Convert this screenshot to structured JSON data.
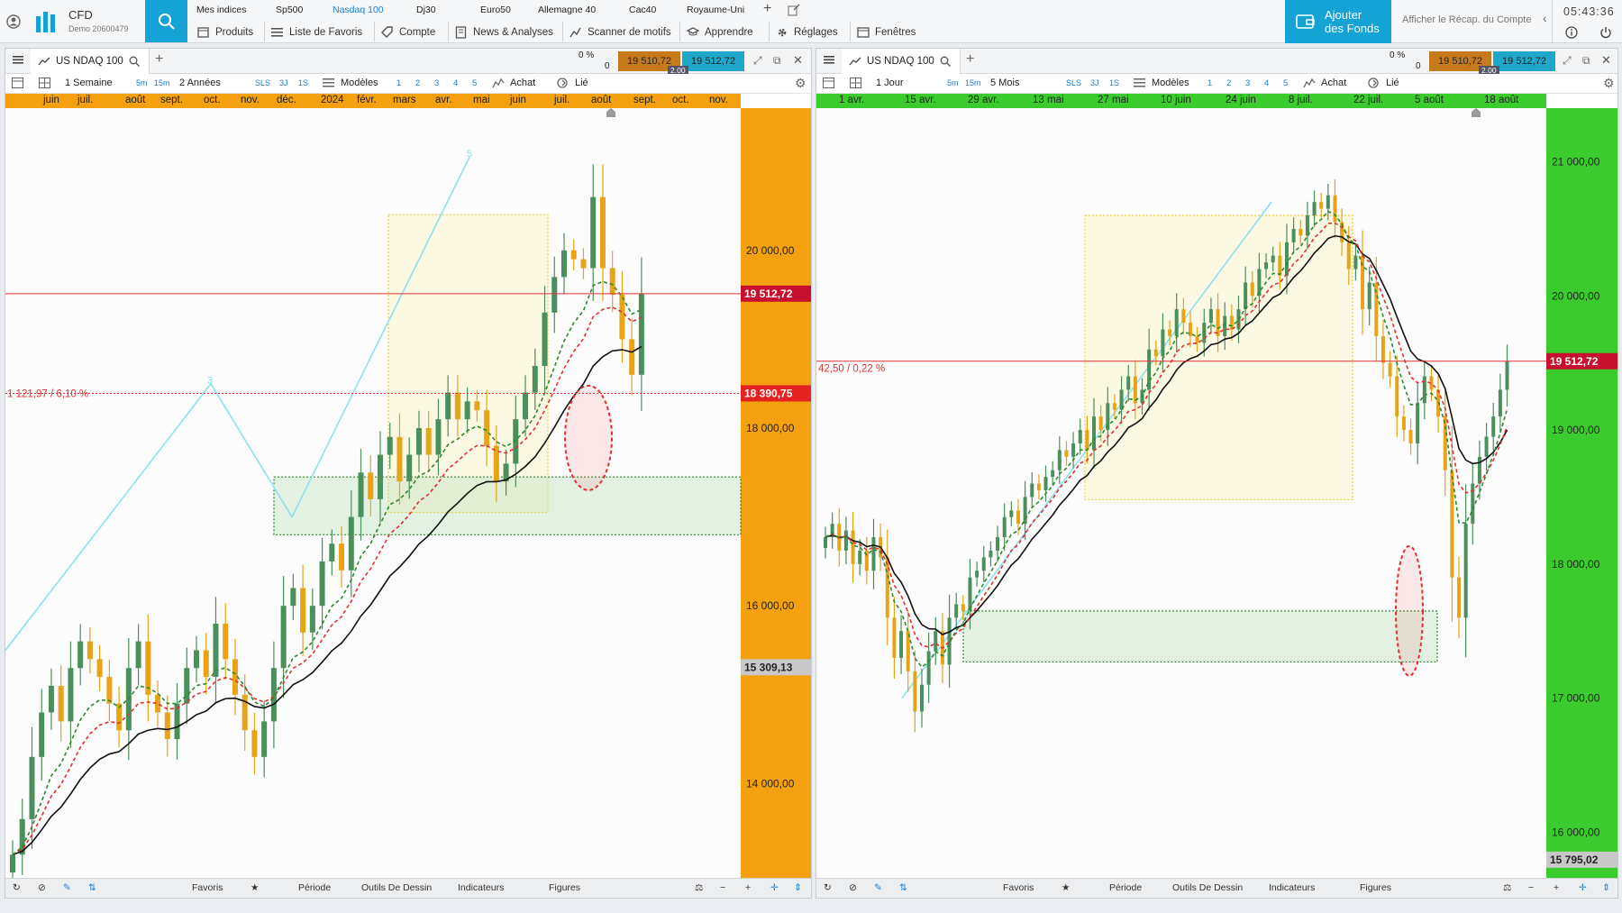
{
  "app": {
    "brand": "CFD",
    "account": "Demo 20600479",
    "clock": "05:43:36"
  },
  "indices": [
    {
      "label": "Mes indices",
      "active": false
    },
    {
      "label": "Sp500",
      "active": false
    },
    {
      "label": "Nasdaq 100",
      "active": true
    },
    {
      "label": "Dj30",
      "active": false
    },
    {
      "label": "Euro50",
      "active": false
    },
    {
      "label": "Allemagne 40",
      "active": false
    },
    {
      "label": "Cac40",
      "active": false
    },
    {
      "label": "Royaume-Uni",
      "active": false
    }
  ],
  "menu": [
    {
      "label": "Produits",
      "icon": "box-icon"
    },
    {
      "label": "Liste de Favoris",
      "icon": "list-icon"
    },
    {
      "label": "Compte",
      "icon": "tag-icon"
    },
    {
      "label": "News & Analyses",
      "icon": "news-icon"
    },
    {
      "label": "Scanner de motifs",
      "icon": "scanner-icon"
    },
    {
      "label": "Apprendre",
      "icon": "learn-icon"
    },
    {
      "label": "Réglages",
      "icon": "gear-icon"
    },
    {
      "label": "Fenêtres",
      "icon": "window-icon"
    }
  ],
  "funds_button": {
    "line1": "Ajouter",
    "line2": "des Fonds"
  },
  "recap_link": "Afficher le Récap. du Compte",
  "footer_items": [
    "Favoris",
    "Période",
    "Outils De Dessin",
    "Indicateurs",
    "Figures"
  ],
  "colors": {
    "accent": "#15a2d4",
    "bullish": "#4a8f5c",
    "bearish": "#e8a317",
    "ma_black": "#111111",
    "ma_red": "#e03030",
    "ma_green": "#2b8a2b",
    "trend": "#8fe0f0",
    "price_line": "#e03030",
    "left_axis": "#f5a00f",
    "right_axis": "#3acc2c"
  },
  "left": {
    "tab": "US NDAQ 100",
    "change_pct": "0 %",
    "change_pts": "0",
    "bid": "19 510,72",
    "ask": "19 512,72",
    "spread": "2.00",
    "interval": "1 Semaine",
    "range": "2 Années",
    "tf_buttons": [
      "5m",
      "15m"
    ],
    "quick": [
      "SLS",
      "3J",
      "1S"
    ],
    "models": "Modèles",
    "nums": [
      "1",
      "2",
      "3",
      "4",
      "5"
    ],
    "buy": "Achat",
    "linked": "Lié",
    "time_labels": [
      "juin",
      "juil.",
      "août",
      "sept.",
      "oct.",
      "nov.",
      "déc.",
      "2024",
      "févr.",
      "mars",
      "avr.",
      "mai",
      "juin",
      "juil.",
      "août",
      "sept.",
      "oct.",
      "nov."
    ],
    "axis_ticks": [
      "20 000,00",
      "18 000,00",
      "16 000,00",
      "14 000,00"
    ],
    "last_price": "19 512,72",
    "line_price": "18 390,75",
    "low_price": "15 309,13",
    "measure": "1 121,97 / 6,10 %",
    "wave_labels": [
      "3",
      "5"
    ]
  },
  "right": {
    "tab": "US NDAQ 100",
    "change_pct": "0 %",
    "change_pts": "0",
    "bid": "19 510,72",
    "ask": "19 512,72",
    "spread": "2.00",
    "interval": "1 Jour",
    "range": "5 Mois",
    "tf_buttons": [
      "5m",
      "15m"
    ],
    "quick": [
      "SLS",
      "3J",
      "1S"
    ],
    "models": "Modèles",
    "nums": [
      "1",
      "2",
      "3",
      "4",
      "5"
    ],
    "buy": "Achat",
    "linked": "Lié",
    "time_labels": [
      "1 avr.",
      "15 avr.",
      "29 avr.",
      "13 mai",
      "27 mai",
      "10 juin",
      "24 juin",
      "8 juil.",
      "22 juil.",
      "5 août",
      "18 août"
    ],
    "axis_ticks": [
      "21 000,00",
      "20 000,00",
      "19 000,00",
      "18 000,00",
      "17 000,00",
      "16 000,00"
    ],
    "last_price": "19 512,72",
    "low_price": "15 795,02",
    "measure": "42,50 / 0,22 %"
  },
  "chart_data": [
    {
      "type": "candlestick",
      "title": "US NDAQ 100",
      "interval": "1 Semaine",
      "range": "2 Années",
      "ylim": [
        13000,
        21600
      ],
      "close": [
        13200,
        13600,
        14300,
        14800,
        15100,
        14700,
        15300,
        15600,
        15400,
        15200,
        14900,
        14600,
        15300,
        15600,
        15000,
        14800,
        14500,
        14900,
        15300,
        15500,
        15200,
        15800,
        15400,
        15000,
        14600,
        14300,
        14700,
        15300,
        16000,
        16200,
        15700,
        16000,
        16500,
        16700,
        16400,
        17000,
        17500,
        17200,
        17700,
        17900,
        17400,
        17700,
        18000,
        17700,
        18100,
        18400,
        18100,
        18300,
        18200,
        17800,
        17400,
        17600,
        18100,
        18400,
        18700,
        19300,
        19700,
        20000,
        19900,
        19800,
        20600,
        19800,
        19500,
        19000,
        18600,
        19512
      ]
    },
    {
      "type": "candlestick",
      "title": "US NDAQ 100",
      "interval": "1 Jour",
      "range": "5 Mois",
      "ylim": [
        15700,
        21400
      ],
      "close": [
        18200,
        18300,
        18100,
        18250,
        18000,
        18100,
        17950,
        18200,
        18050,
        17600,
        17300,
        17500,
        17200,
        16900,
        17100,
        17350,
        17500,
        17250,
        17600,
        17700,
        17650,
        17900,
        17950,
        18050,
        18100,
        18200,
        18350,
        18400,
        18300,
        18500,
        18600,
        18550,
        18650,
        18700,
        18850,
        18800,
        18900,
        19000,
        18850,
        19100,
        19000,
        19200,
        19150,
        19300,
        19400,
        19200,
        19300,
        19600,
        19550,
        19750,
        19700,
        19900,
        19800,
        19700,
        19650,
        19800,
        19900,
        19700,
        19850,
        19750,
        19900,
        20100,
        20000,
        20200,
        20250,
        20300,
        20150,
        20400,
        20500,
        20450,
        20600,
        20700,
        20650,
        20750,
        20550,
        20400,
        20200,
        20300,
        19900,
        20100,
        19700,
        19500,
        19400,
        19100,
        19000,
        18900,
        19200,
        19400,
        19300,
        19100,
        18700,
        17900,
        17600,
        18300,
        18600,
        18800,
        18950,
        19100,
        19300,
        19512
      ]
    }
  ]
}
